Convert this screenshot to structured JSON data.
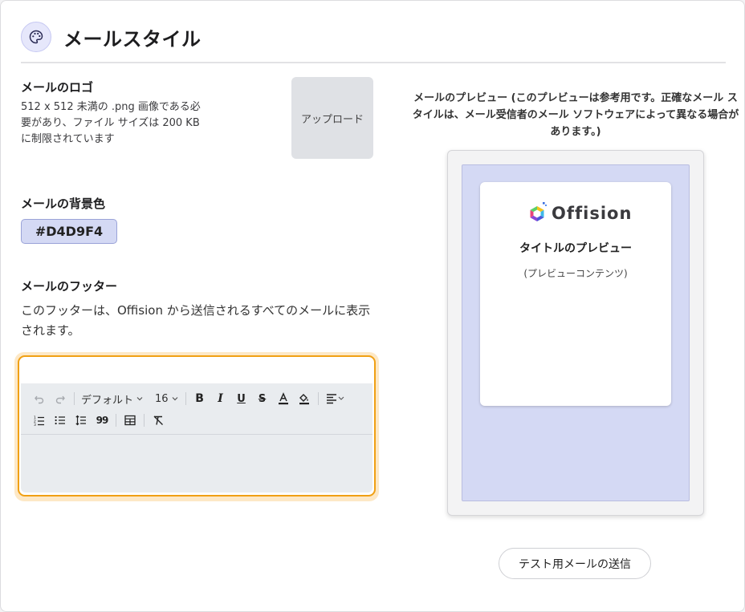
{
  "header": {
    "title": "メールスタイル",
    "icon": "palette-icon"
  },
  "logo_section": {
    "label": "メールのロゴ",
    "description": "512 x 512 未満の .png 画像である必要があり、ファイル サイズは 200 KB に制限されています",
    "upload_label": "アップロード"
  },
  "background_section": {
    "label": "メールの背景色",
    "color_value": "#D4D9F4"
  },
  "footer_section": {
    "label": "メールのフッター",
    "description": "このフッターは、Offision から送信されるすべてのメールに表示されます。"
  },
  "editor": {
    "font_family": "デフォルト",
    "font_size": "16",
    "accent_color": "#F0A014",
    "toolbar_icons": [
      "undo-icon",
      "redo-icon",
      "bold-icon",
      "italic-icon",
      "underline-icon",
      "strikethrough-icon",
      "font-color-icon",
      "highlight-icon",
      "align-icon",
      "ordered-list-icon",
      "bullet-list-icon",
      "line-height-icon",
      "quote-icon",
      "table-icon",
      "clear-format-icon"
    ]
  },
  "preview": {
    "caption": "メールのプレビュー (このプレビューは参考用です。正確なメール スタイルは、メール受信者のメール ソフトウェアによって異なる場合があります。)",
    "logo_text": "Offision",
    "title": "タイトルのプレビュー",
    "content": "(プレビューコンテンツ)",
    "background_color": "#D4D9F4"
  },
  "actions": {
    "send_test_label": "テスト用メールの送信"
  }
}
